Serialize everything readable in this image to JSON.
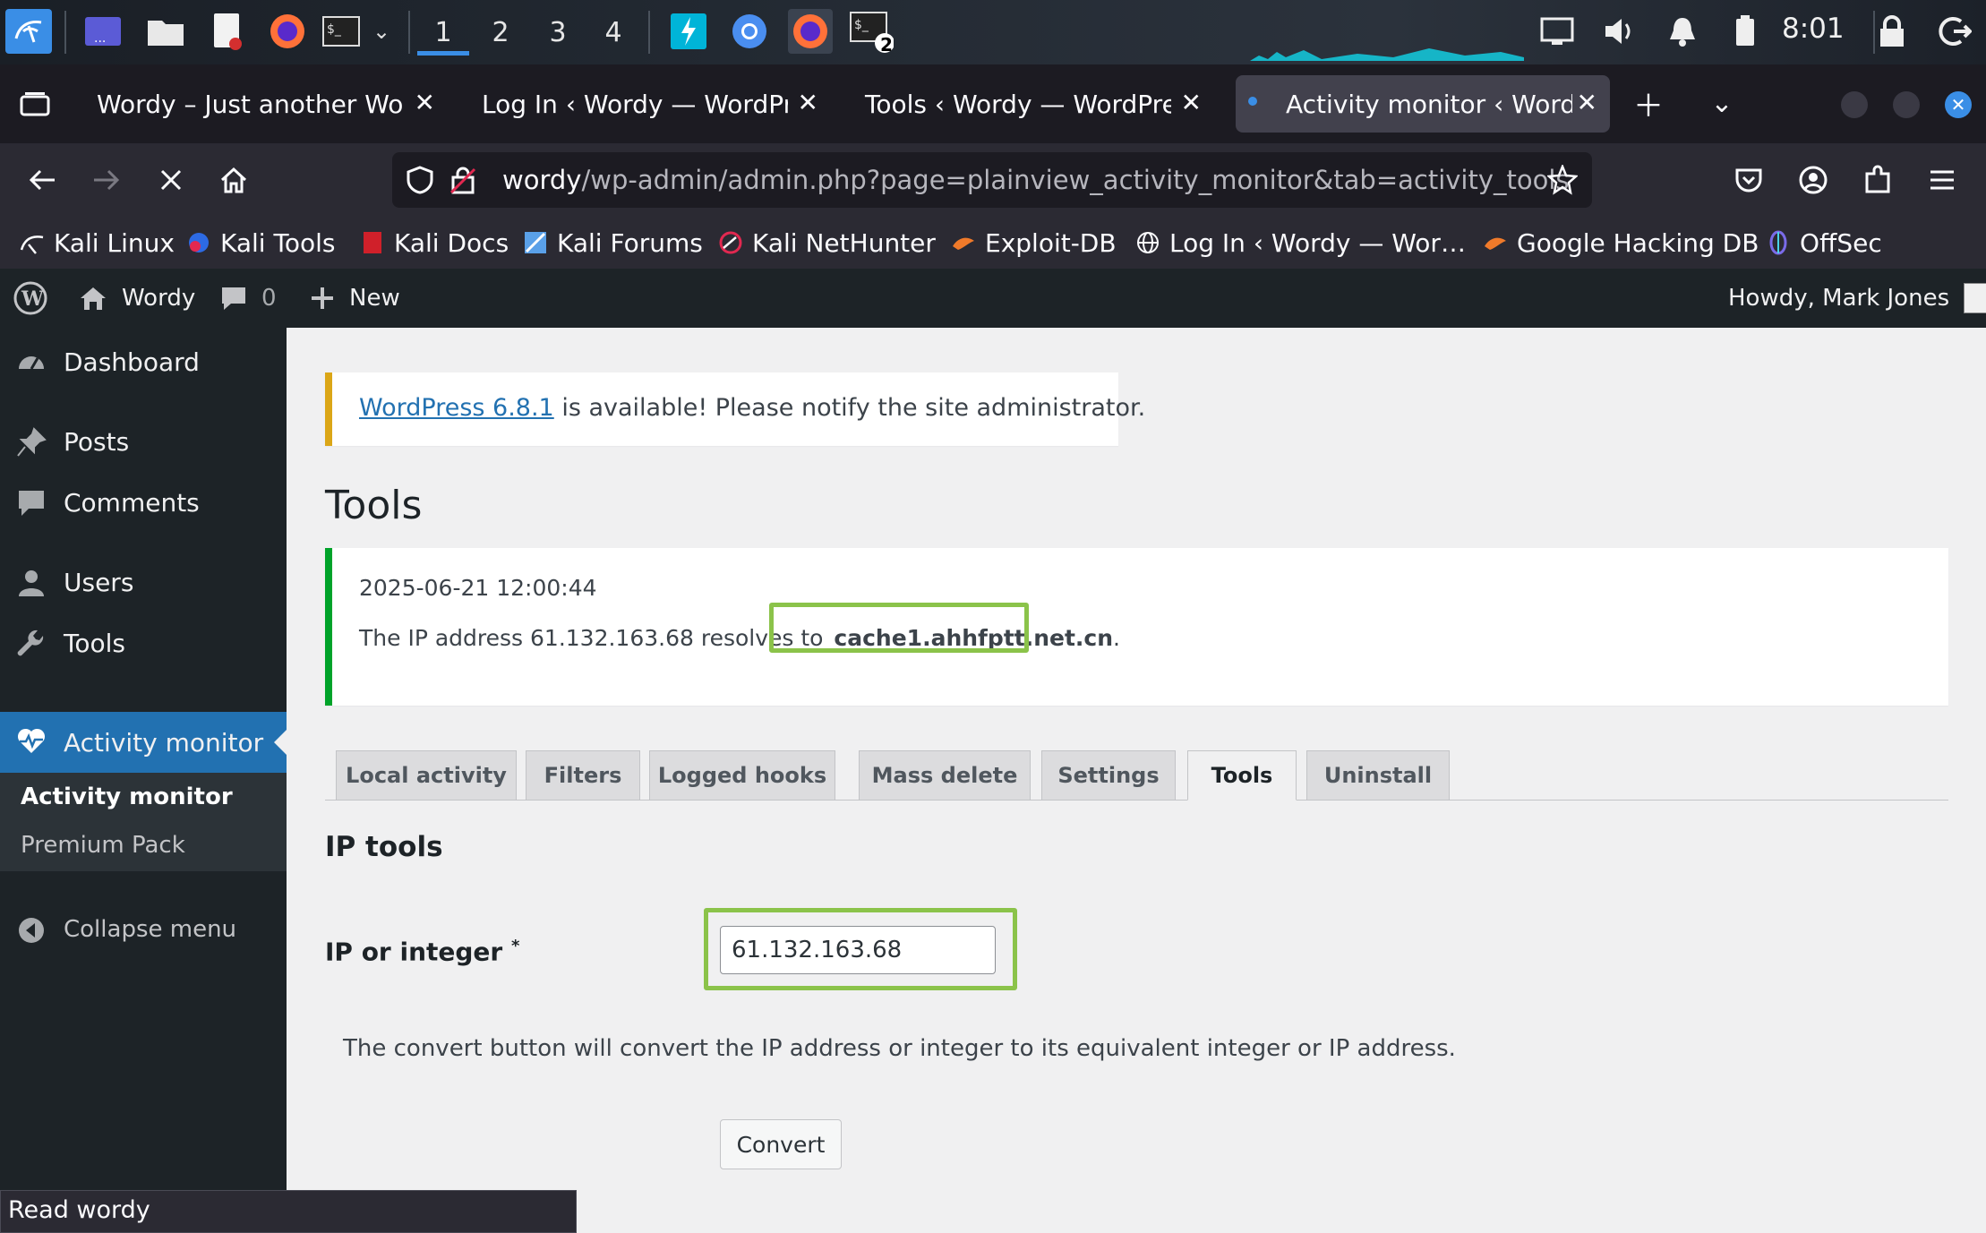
{
  "taskbar": {
    "workspaces": [
      "1",
      "2",
      "3",
      "4"
    ],
    "terminal_badge": "2",
    "clock": "8:01"
  },
  "browser": {
    "tabs": [
      {
        "title": "Wordy – Just another WordPress site"
      },
      {
        "title": "Log In ‹ Wordy — WordPress"
      },
      {
        "title": "Tools ‹ Wordy — WordPress"
      },
      {
        "title": "Activity monitor ‹ Wordy — WordPress"
      }
    ],
    "url_host": "wordy",
    "url_path": "/wp-admin/admin.php?page=plainview_activity_monitor&tab=activity_tools",
    "bookmarks": [
      "Kali Linux",
      "Kali Tools",
      "Kali Docs",
      "Kali Forums",
      "Kali NetHunter",
      "Exploit-DB",
      "Log In ‹ Wordy — Wor…",
      "Google Hacking DB",
      "OffSec"
    ],
    "status": "Read wordy"
  },
  "adminbar": {
    "site": "Wordy",
    "comments_count": "0",
    "new_label": "New",
    "greeting": "Howdy, Mark Jones"
  },
  "menu": {
    "dashboard": "Dashboard",
    "posts": "Posts",
    "comments": "Comments",
    "users": "Users",
    "tools": "Tools",
    "activity": "Activity monitor",
    "sub_activity": "Activity monitor",
    "sub_premium": "Premium Pack",
    "collapse": "Collapse menu"
  },
  "content": {
    "update_link": "WordPress 6.8.1",
    "update_text": " is available! Please notify the site administrator.",
    "page_title": "Tools",
    "notice_date": "2025-06-21 12:00:44",
    "notice_prefix": "The IP address 61.132.163.68 resolves to ",
    "notice_host": "cache1.ahhfptt.net.cn",
    "notice_suffix": ".",
    "tabs": [
      "Local activity",
      "Filters",
      "Logged hooks",
      "Mass delete",
      "Settings",
      "Tools",
      "Uninstall"
    ],
    "active_tab": "Tools",
    "section_heading": "IP tools",
    "field_label": "IP or integer",
    "field_required": "*",
    "field_value": "61.132.163.68",
    "field_description": "The convert button will convert the IP address or integer to its equivalent integer or IP address.",
    "convert_label": "Convert"
  },
  "colors": {
    "wp_blue": "#2271b1",
    "highlight_green": "#8bc34a",
    "notice_green": "#00a32a",
    "nag_yellow": "#dba617"
  }
}
